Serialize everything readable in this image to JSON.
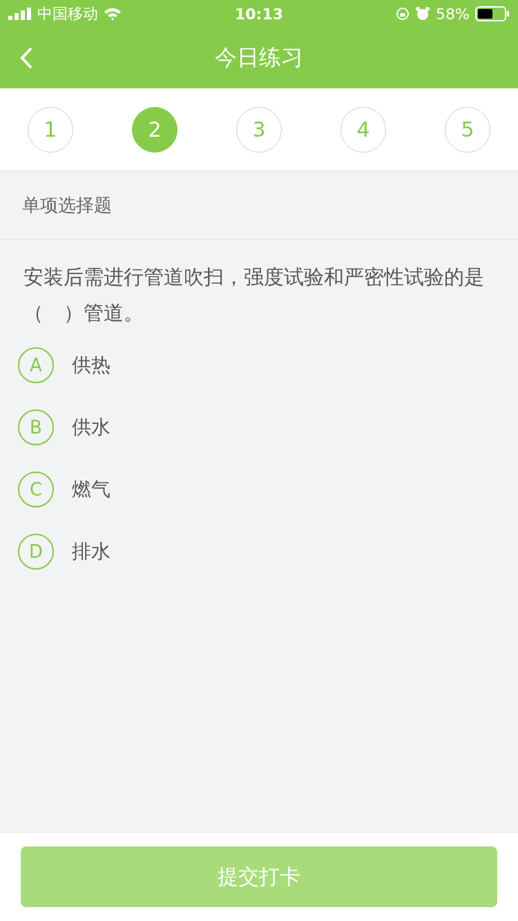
{
  "status_bar": {
    "carrier": "中国移动",
    "time": "10:13",
    "battery": "58%"
  },
  "nav": {
    "title": "今日练习"
  },
  "steps": [
    {
      "label": "1",
      "selected": false
    },
    {
      "label": "2",
      "selected": true
    },
    {
      "label": "3",
      "selected": false
    },
    {
      "label": "4",
      "selected": false
    },
    {
      "label": "5",
      "selected": false
    }
  ],
  "section_title": "单项选择题",
  "question": "安装后需进行管道吹扫，强度试验和严密性试验的是（　）管道。",
  "options": [
    {
      "letter": "A",
      "text": "供热",
      "selected": false
    },
    {
      "letter": "B",
      "text": "供水",
      "selected": false
    },
    {
      "letter": "C",
      "text": "燃气",
      "selected": false
    },
    {
      "letter": "D",
      "text": "排水",
      "selected": false
    }
  ],
  "submit": {
    "label": "提交打卡",
    "disabled": true
  }
}
